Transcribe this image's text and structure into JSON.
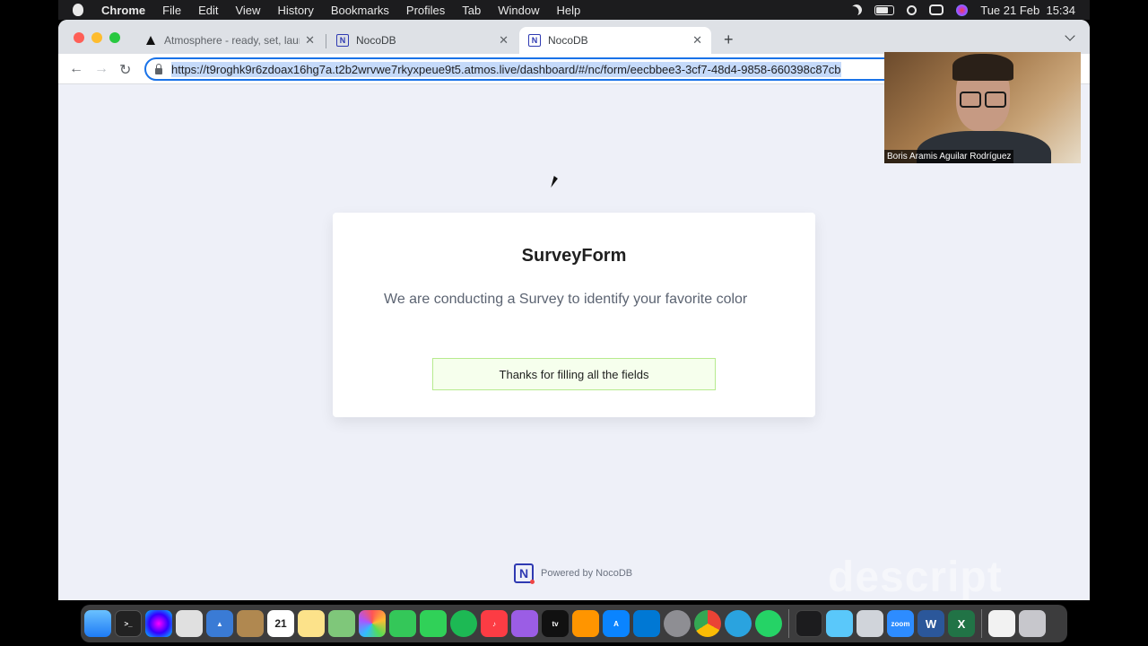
{
  "menubar": {
    "app_name": "Chrome",
    "menus": [
      "File",
      "Edit",
      "View",
      "History",
      "Bookmarks",
      "Profiles",
      "Tab",
      "Window",
      "Help"
    ],
    "clock": "Tue 21 Feb  15:34"
  },
  "browser": {
    "tabs": [
      {
        "title": "Atmosphere - ready, set, launch",
        "favicon": "atmosphere-icon",
        "active": false
      },
      {
        "title": "NocoDB",
        "favicon": "nocodb-icon",
        "active": false
      },
      {
        "title": "NocoDB",
        "favicon": "nocodb-icon",
        "active": true
      }
    ],
    "url": "https://t9roghk9r6zdoax16hg7a.t2b2wrvwe7rkyxpeue9t5.atmos.live/dashboard/#/nc/form/eecbbee3-3cf7-48d4-9858-660398c87cb"
  },
  "form": {
    "title": "SurveyForm",
    "description": "We are conducting a Survey to identify your favorite color",
    "success_message": "Thanks for filling all the fields"
  },
  "footer": {
    "powered_by": "Powered by NocoDB",
    "logo_letter": "N"
  },
  "watermark": "descript",
  "video": {
    "participant_name": "Boris Aramis Aguilar Rodríguez"
  },
  "dock": {
    "icons": [
      "finder-icon",
      "terminal-icon",
      "siri-icon",
      "launchpad-icon",
      "altair-icon",
      "contacts-icon",
      "calendar-icon",
      "notes-icon",
      "maps-icon",
      "photos-icon",
      "messages-icon",
      "facetime-icon",
      "spotify-icon",
      "music-icon",
      "podcasts-icon",
      "tv-icon",
      "books-icon",
      "app-store-icon",
      "vscode-icon",
      "settings-icon",
      "chrome-icon",
      "telegram-icon",
      "whatsapp-icon",
      "activity-monitor-icon",
      "network-icon",
      "preview-icon",
      "zoom-icon",
      "word-icon",
      "excel-icon",
      "document-icon",
      "trash-icon"
    ],
    "calendar_day": "21",
    "tv_label": "tv",
    "zoom_label": "zoom",
    "word_label": "W",
    "excel_label": "X"
  },
  "colors": {
    "accent": "#1a73e8",
    "success_bg": "#f6ffed",
    "success_border": "#b7eb8f",
    "page_bg": "#eef0f8",
    "nocodb_brand": "#2f3ab2"
  }
}
